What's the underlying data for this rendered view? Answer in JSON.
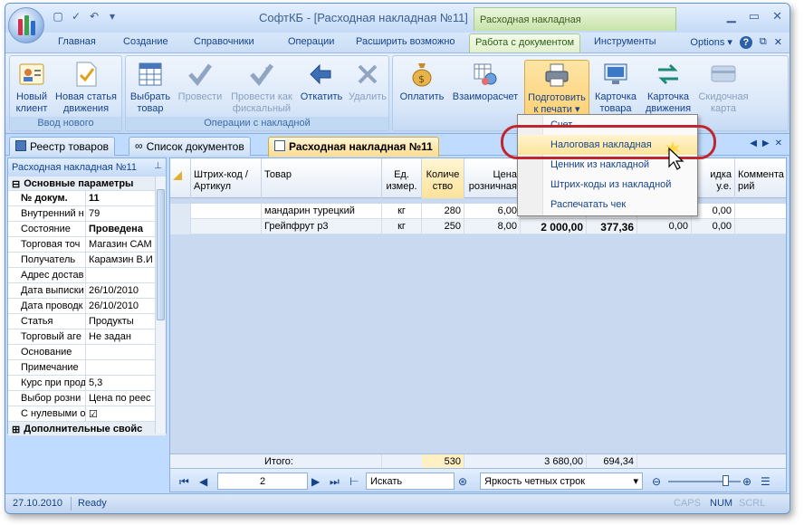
{
  "app": {
    "title": "СофтКБ - [Расходная накладная №11]",
    "context_tab_group": "Расходная накладная"
  },
  "ribbon_tabs": [
    "Главная",
    "Создание",
    "Справочники",
    "Операции",
    "Расширить возможно",
    "Работа с документом",
    "Инструменты"
  ],
  "right_tools": {
    "options": "Options",
    "help": "?"
  },
  "groups": {
    "new": {
      "label": "Ввод нового",
      "buttons": [
        {
          "line1": "Новый",
          "line2": "клиент",
          "icon": "client-card-icon"
        },
        {
          "line1": "Новая статья",
          "line2": "движения",
          "icon": "document-check-icon"
        }
      ]
    },
    "ops": {
      "label": "Операции с накладной",
      "buttons": [
        {
          "line1": "Выбрать",
          "line2": "товар",
          "icon": "table-grid-icon"
        },
        {
          "line1": "Провести",
          "line2": "",
          "icon": "checkmark-icon"
        },
        {
          "line1": "Провести как",
          "line2": "фискальный",
          "icon": "fiscal-check-icon"
        },
        {
          "line1": "Откатить",
          "line2": "",
          "icon": "undo-arrow-icon"
        },
        {
          "line1": "Удалить",
          "line2": "",
          "icon": "delete-x-icon"
        }
      ]
    },
    "doc": {
      "buttons": [
        {
          "line1": "Оплатить",
          "line2": "",
          "icon": "money-bag-icon"
        },
        {
          "line1": "Взаиморасчет",
          "line2": "",
          "icon": "settlement-icon"
        },
        {
          "line1": "Подготовить",
          "line2": "к печати",
          "icon": "printer-icon"
        },
        {
          "line1": "Карточка",
          "line2": "товара",
          "icon": "monitor-card-icon"
        },
        {
          "line1": "Карточка",
          "line2": "движения",
          "icon": "swap-arrows-icon"
        },
        {
          "line1": "Скидочная",
          "line2": "карта",
          "icon": "discount-card-icon"
        }
      ]
    }
  },
  "print_menu": [
    "Счет",
    "Налоговая накладная",
    "Ценник из накладной",
    "Штрих-коды из накладной",
    "Распечатать чек"
  ],
  "doc_tabs": [
    "Реестр товаров",
    "Список документов",
    "Расходная накладная №11"
  ],
  "left_panel": {
    "title": "Расходная накладная №11",
    "group1": "Основные параметры",
    "rows": [
      {
        "k": "№ докум.",
        "v": "11",
        "bold": true
      },
      {
        "k": "Внутренний н",
        "v": "79"
      },
      {
        "k": "Состояние",
        "v": "Проведена",
        "bold_v": true
      },
      {
        "k": "Торговая точ",
        "v": "Магазин САМ"
      },
      {
        "k": "Получатель",
        "v": "Карамзин В.И"
      },
      {
        "k": "Адрес достав",
        "v": ""
      },
      {
        "k": "Дата выписки",
        "v": "26/10/2010"
      },
      {
        "k": "Дата проводк",
        "v": "26/10/2010"
      },
      {
        "k": "Статья",
        "v": "Продукты"
      },
      {
        "k": "Торговый аге",
        "v": "Не задан"
      },
      {
        "k": "Основание",
        "v": ""
      },
      {
        "k": "Примечание",
        "v": ""
      },
      {
        "k": "Курс при прод",
        "v": "5,3"
      },
      {
        "k": "Выбор розни",
        "v": "Цена по реес"
      },
      {
        "k": "С нулевыми о",
        "v": "☑"
      }
    ],
    "group2": "Дополнительные свойс"
  },
  "grid": {
    "headers": {
      "barcode": "Штрих-код / Артикул",
      "product": "Товар",
      "unit": "Ед. измер.",
      "qty": "Количе ство",
      "price": "Цена розничная",
      "discount": "идка у.е.",
      "comment": "Коммента рий"
    },
    "rows": [
      {
        "product": "мандарин турецкий",
        "unit": "кг",
        "qty": "280",
        "price": "6,00",
        "d": "0,00"
      },
      {
        "product": "Грейпфрут р3",
        "unit": "кг",
        "qty": "250",
        "price": "8,00",
        "sum": "2 000,00",
        "sum2": "377,36",
        "z1": "0,00",
        "d": "0,00"
      }
    ],
    "totals": {
      "label": "Итого:",
      "qty": "530",
      "sum": "3 680,00",
      "sum2": "694,34"
    },
    "nav": {
      "page": "2",
      "search": "Искать",
      "brightness": "Яркость четных строк"
    }
  },
  "status": {
    "date": "27.10.2010",
    "state": "Ready",
    "caps": "CAPS",
    "num": "NUM",
    "scrl": "SCRL"
  }
}
